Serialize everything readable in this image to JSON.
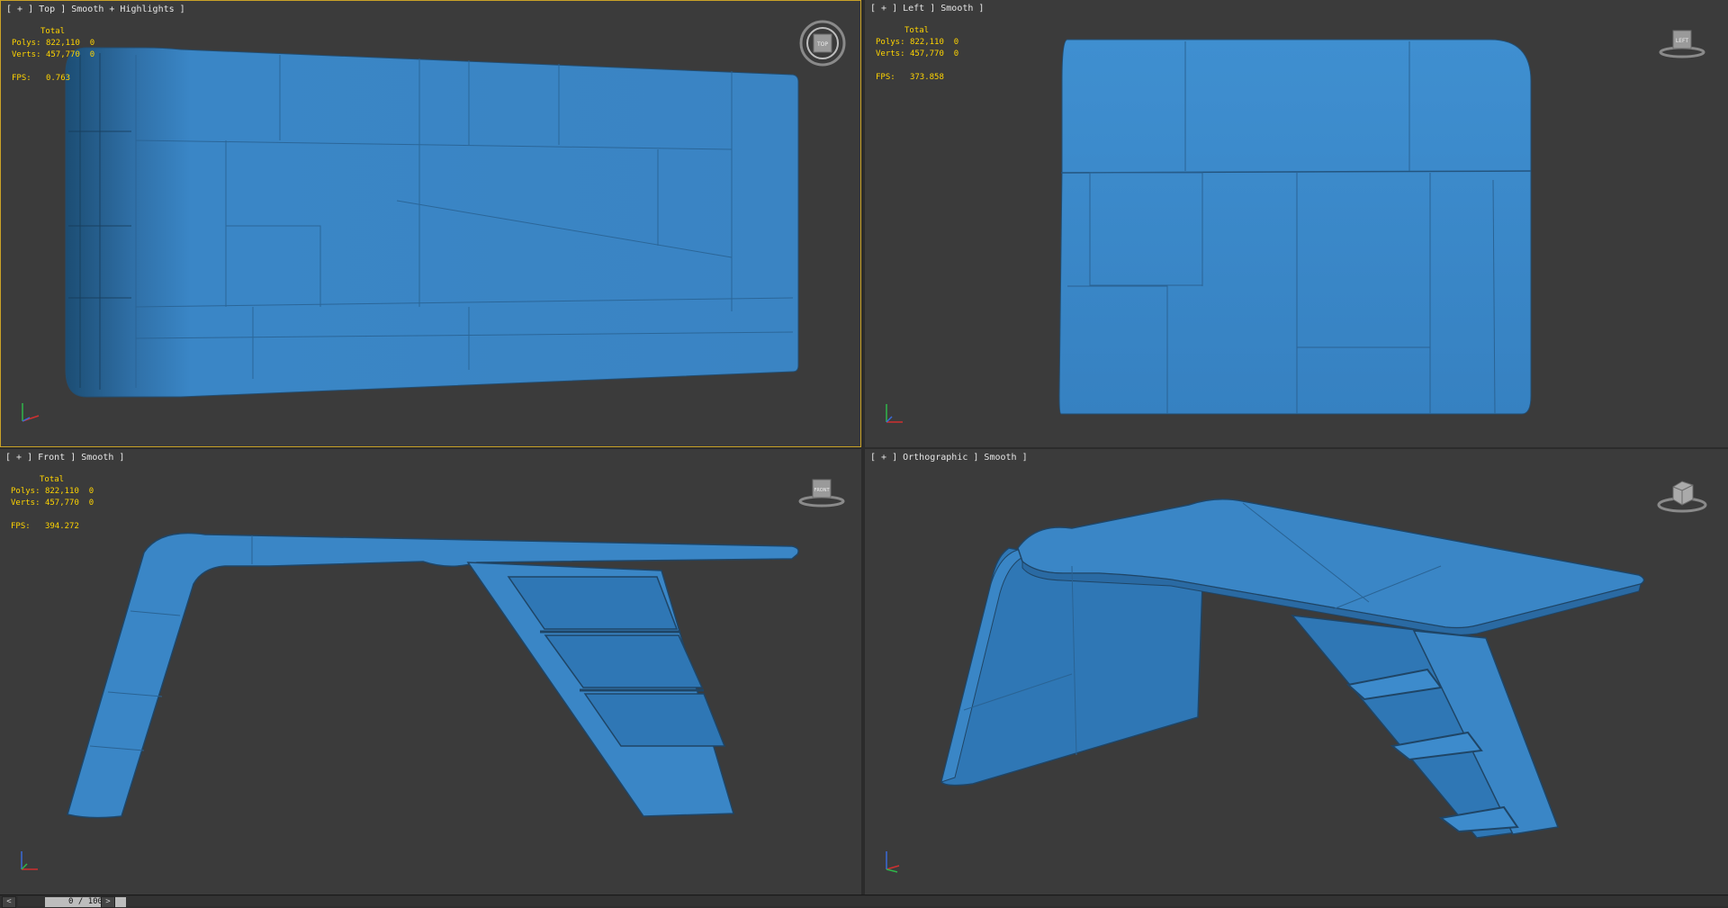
{
  "viewports": {
    "top": {
      "label": "[ + ] Top ] Smooth + Highlights ]",
      "cube": "TOP",
      "fps": "0.763"
    },
    "left": {
      "label": "[ + ] Left ] Smooth ]",
      "cube": "LEFT",
      "fps": "373.858"
    },
    "front": {
      "label": "[ + ] Front ] Smooth ]",
      "cube": "FRONT",
      "fps": "394.272"
    },
    "persp": {
      "label": "[ + ] Orthographic ] Smooth ]",
      "cube": ""
    }
  },
  "stats": {
    "total_label": "Total",
    "polys_label": "Polys:",
    "polys_value": "822,110",
    "polys_sel": "0",
    "verts_label": "Verts:",
    "verts_value": "457,770",
    "verts_sel": "0",
    "fps_label": "FPS:"
  },
  "timeline": {
    "prev": "<",
    "next": ">",
    "position": "0 / 100"
  },
  "colors": {
    "viewport_bg": "#3b3b3b",
    "model": "#3a86c6",
    "active_border": "#c9a227",
    "stats_text": "#ffd400"
  },
  "icons": [
    "viewcube-icon",
    "axis-tripod-icon"
  ]
}
